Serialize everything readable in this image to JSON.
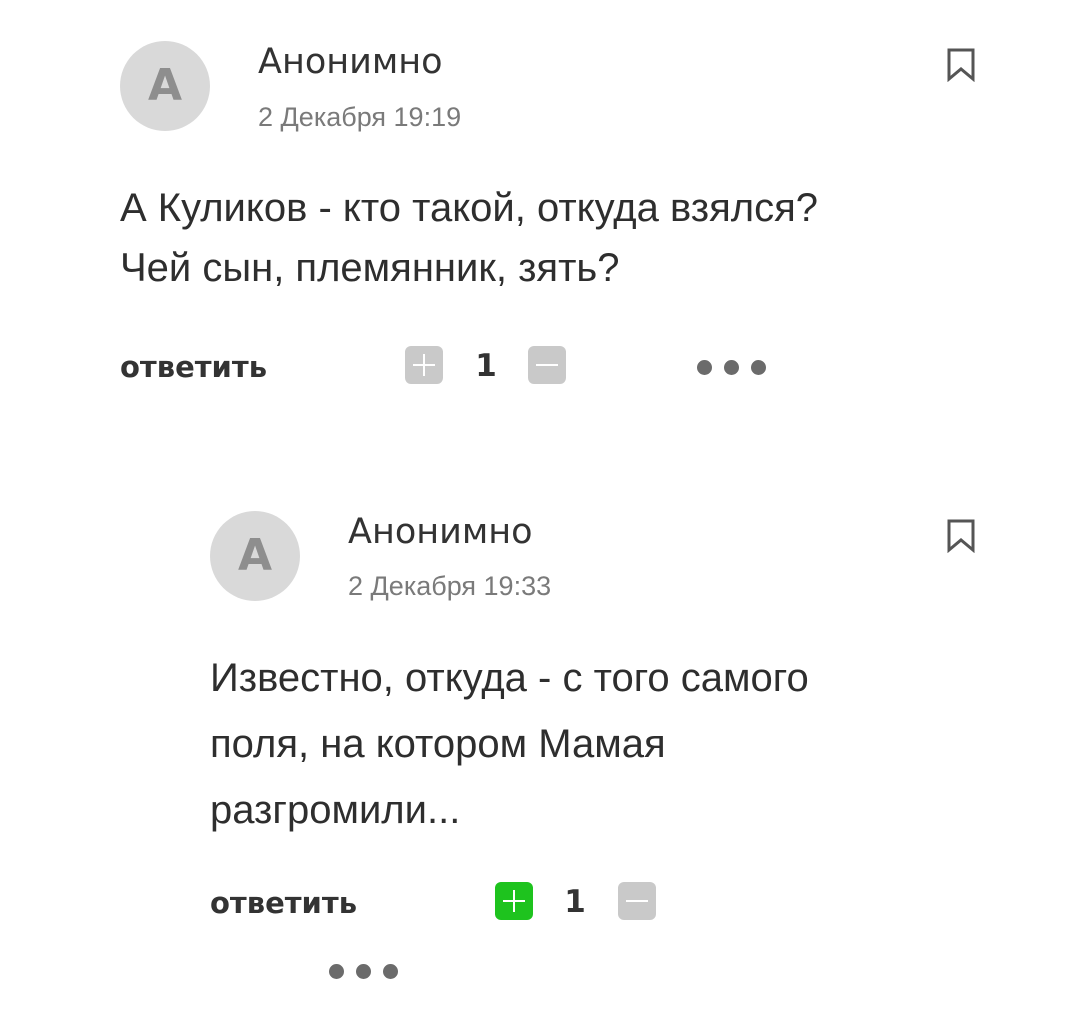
{
  "comments": [
    {
      "avatar_letter": "А",
      "author": "Анонимно",
      "date": "2 Декабря 19:19",
      "text_lines": [
        "А Куликов - кто такой, откуда взялся?",
        "Чей сын, племянник, зять?"
      ],
      "reply_label": "ответить",
      "score": "1",
      "upvoted": false
    },
    {
      "avatar_letter": "А",
      "author": "Анонимно",
      "date": "2 Декабря 19:33",
      "text_lines": [
        "Известно, откуда - с того самого",
        "поля, на котором Мамая",
        "разгромили..."
      ],
      "reply_label": "ответить",
      "score": "1",
      "upvoted": true
    }
  ],
  "icons": {
    "bookmark": "bookmark-icon",
    "more": "more-dots-icon",
    "upvote": "plus-icon",
    "downvote": "minus-icon"
  },
  "colors": {
    "upvote_active": "#1ec31e",
    "vote_inactive": "#c9c9c9",
    "avatar_bg": "#d9d9d9"
  }
}
